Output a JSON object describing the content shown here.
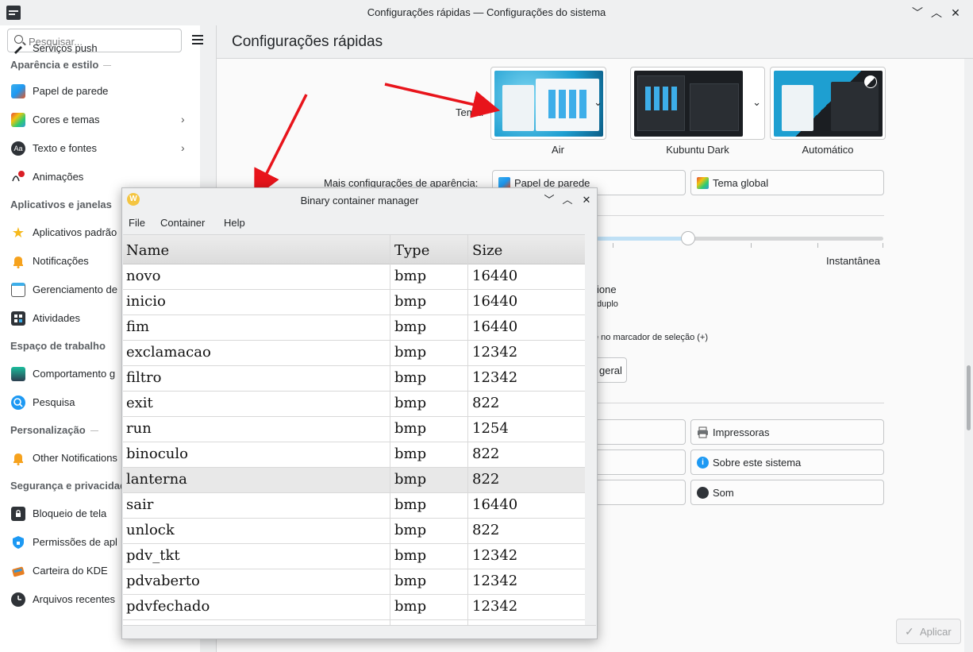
{
  "window": {
    "title": "Configurações rápidas — Configurações do sistema",
    "min_glyph": "﹀",
    "max_glyph": "︿",
    "close_glyph": "✕"
  },
  "sidebar": {
    "search_placeholder": "Pesquisar...",
    "top_partial_item": "Serviços push",
    "sections": [
      {
        "title": "Aparência e estilo"
      },
      {
        "title": "Aplicativos e janelas"
      },
      {
        "title": "Espaço de trabalho"
      },
      {
        "title": "Personalização"
      },
      {
        "title": "Segurança e privacidade"
      }
    ],
    "items": [
      {
        "label": "Papel de parede",
        "icon": "wallpaper-icon"
      },
      {
        "label": "Cores e temas",
        "icon": "colors-icon",
        "has_children": true
      },
      {
        "label": "Texto e fontes",
        "icon": "fonts-icon",
        "has_children": true
      },
      {
        "label": "Animações",
        "icon": "animations-icon"
      },
      {
        "label": "Aplicativos padrão",
        "icon": "star-icon"
      },
      {
        "label": "Notificações",
        "icon": "bell-icon"
      },
      {
        "label": "Gerenciamento de",
        "icon": "window-icon"
      },
      {
        "label": "Atividades",
        "icon": "activities-icon"
      },
      {
        "label": "Comportamento g",
        "icon": "workspace-icon"
      },
      {
        "label": "Pesquisa",
        "icon": "search-icon"
      },
      {
        "label": "Other Notifications",
        "icon": "bell-icon"
      },
      {
        "label": "Bloqueio de tela",
        "icon": "lock-screen-icon"
      },
      {
        "label": "Permissões de apl",
        "icon": "shield-icon"
      },
      {
        "label": "Carteira do KDE",
        "icon": "wallet-icon"
      },
      {
        "label": "Arquivos recentes",
        "icon": "clock-icon"
      }
    ],
    "chevron": "›"
  },
  "content": {
    "page_title": "Configurações rápidas",
    "theme_label": "Tema:",
    "themes": [
      {
        "name": "Air"
      },
      {
        "name": "Kubuntu Dark"
      },
      {
        "name": "Automático"
      }
    ],
    "dropdown_glyph": "⌄",
    "more_appearance_label": "Mais configurações de aparência:",
    "wallpaper_button": "Papel de parede",
    "global_theme_button": "Tema global",
    "slider_end_label": "Instantânea",
    "partial_text_1": "ione",
    "partial_text_2": "duplo",
    "partial_text_3": "e no marcador de seleção (+)",
    "partial_button": "geral",
    "printers_button": "Impressoras",
    "about_button": "Sobre este sistema",
    "sound_button": "Som",
    "apply_button": "Aplicar",
    "apply_glyph": "✓"
  },
  "dialog": {
    "title": "Binary container manager",
    "icon_letter": "W",
    "menu": [
      "File",
      "Container",
      "Help"
    ],
    "columns": [
      "Name",
      "Type",
      "Size"
    ],
    "rows": [
      {
        "name": "novo",
        "type": "bmp",
        "size": "16440"
      },
      {
        "name": "inicio",
        "type": "bmp",
        "size": "16440"
      },
      {
        "name": "fim",
        "type": "bmp",
        "size": "16440"
      },
      {
        "name": "exclamacao",
        "type": "bmp",
        "size": "12342"
      },
      {
        "name": "filtro",
        "type": "bmp",
        "size": "12342"
      },
      {
        "name": "exit",
        "type": "bmp",
        "size": "822"
      },
      {
        "name": "run",
        "type": "bmp",
        "size": "1254"
      },
      {
        "name": "binoculo",
        "type": "bmp",
        "size": "822"
      },
      {
        "name": "lanterna",
        "type": "bmp",
        "size": "822"
      },
      {
        "name": "sair",
        "type": "bmp",
        "size": "16440"
      },
      {
        "name": "unlock",
        "type": "bmp",
        "size": "822"
      },
      {
        "name": "pdv_tkt",
        "type": "bmp",
        "size": "12342"
      },
      {
        "name": "pdvaberto",
        "type": "bmp",
        "size": "12342"
      },
      {
        "name": "pdvfechado",
        "type": "bmp",
        "size": "12342"
      }
    ],
    "highlighted_row_index": 8
  },
  "colors": {
    "accent_red": "#e8141b",
    "selection": "#e8e8e8",
    "window_bg": "#eff0f1"
  }
}
